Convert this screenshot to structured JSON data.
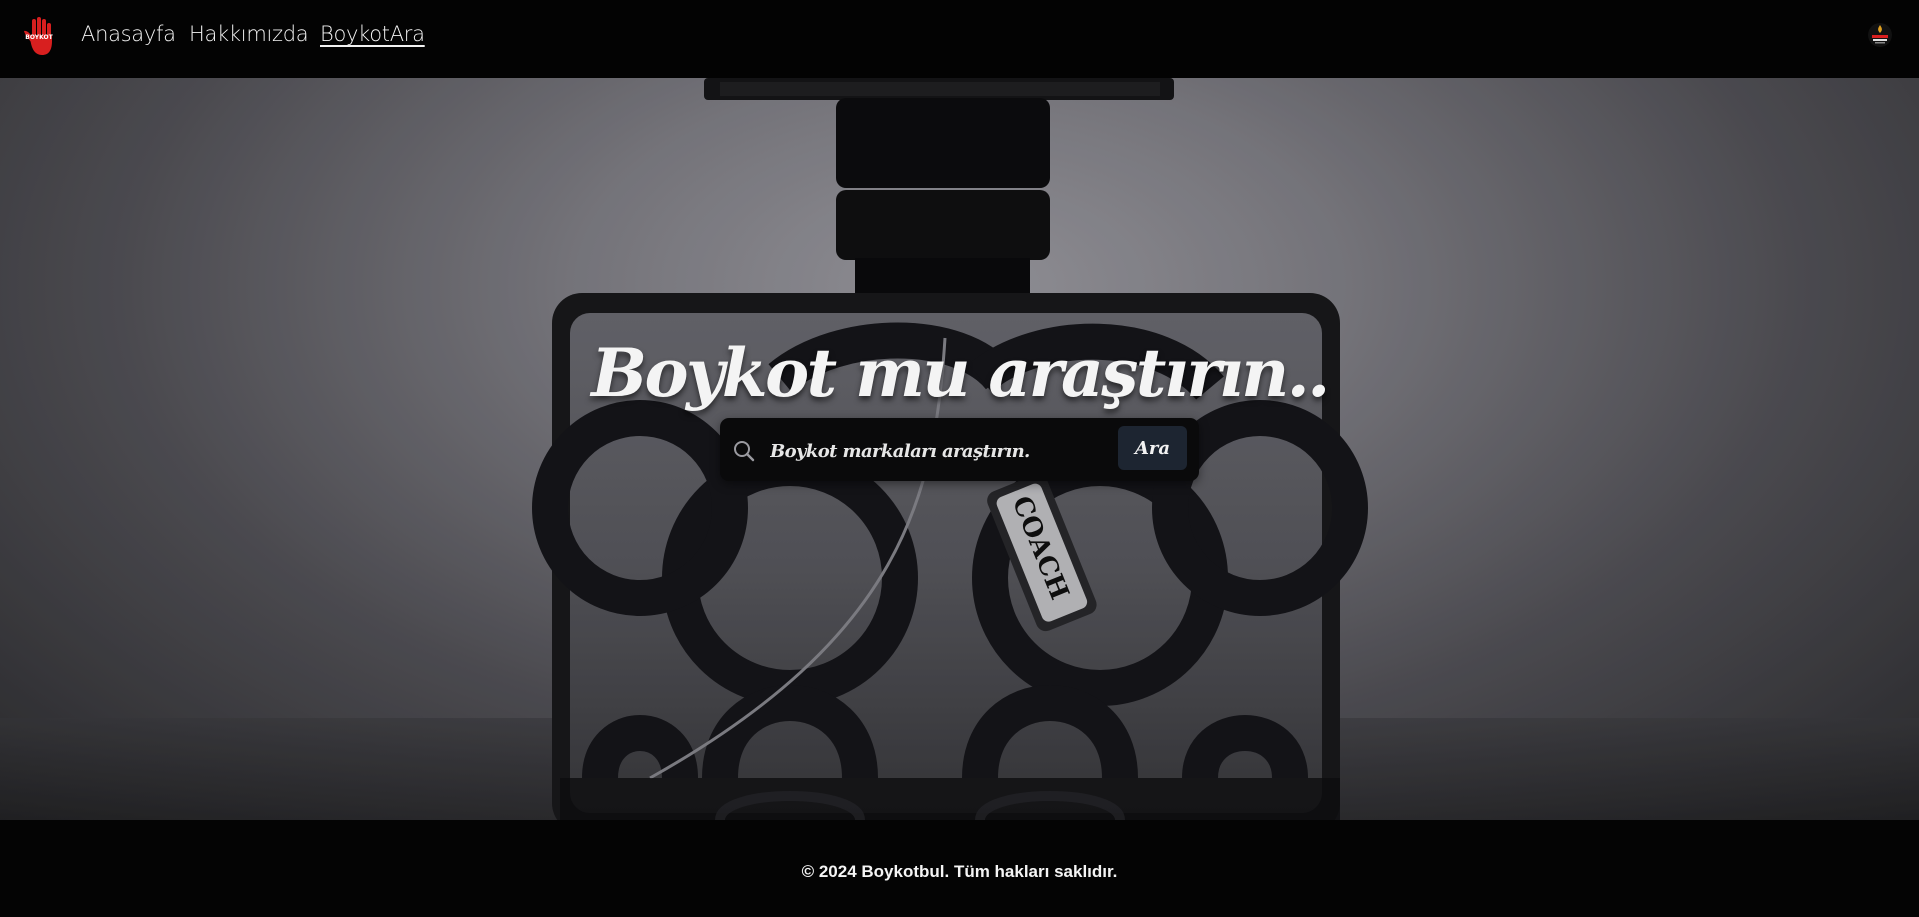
{
  "colors": {
    "navbar": "#030303",
    "footer": "#040404",
    "search_bar": "#0a0a0b",
    "search_button": "#1d2531",
    "logo_hand": "#d81f1f",
    "text": "#f4f4f4"
  },
  "navbar": {
    "logo_text": "BOYKOT",
    "links": [
      {
        "label": "Anasayfa",
        "icon": null
      },
      {
        "label": "Hakkımızda",
        "icon": null
      },
      {
        "label": "BoykotAra",
        "active": true
      }
    ],
    "right_icon": "boykot-badge-icon"
  },
  "hero": {
    "title": "Boykot mu araştırın..",
    "bottle_label": "COACH",
    "search": {
      "icon": "search-icon",
      "placeholder": "Boykot markaları araştırın.",
      "value": "",
      "button_label": "Ara"
    }
  },
  "footer": {
    "copyright": "© 2024 Boykotbul. Tüm hakları saklıdır."
  }
}
